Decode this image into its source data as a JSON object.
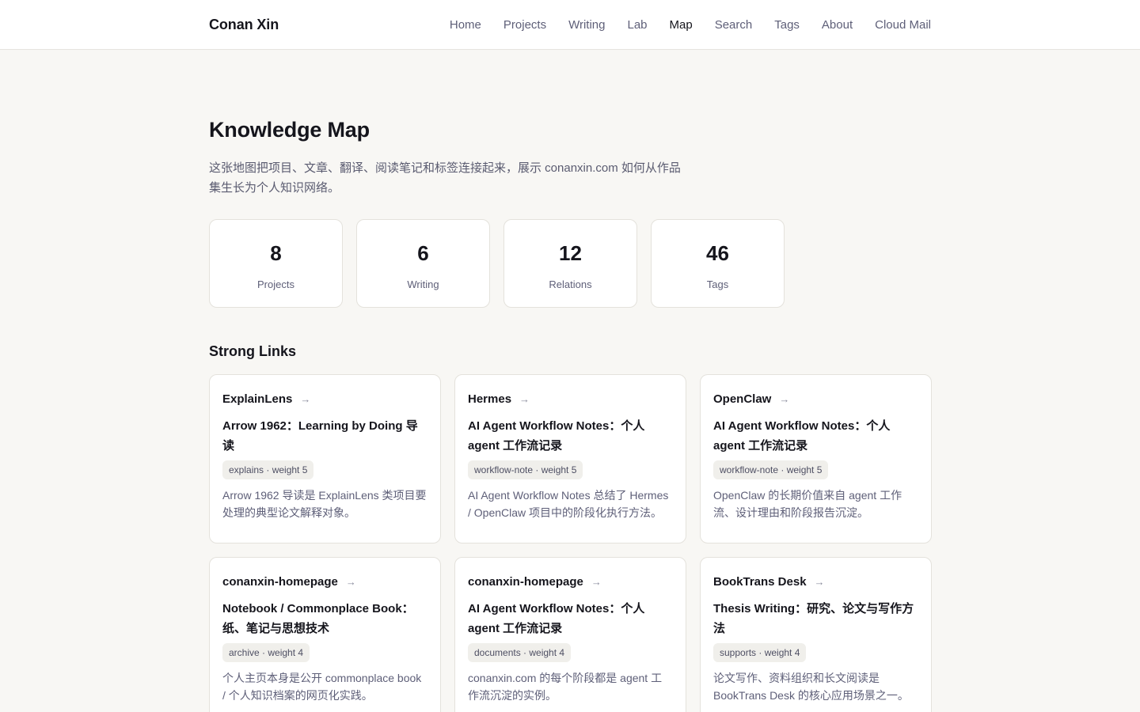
{
  "header": {
    "brand": "Conan Xin",
    "nav": [
      {
        "label": "Home"
      },
      {
        "label": "Projects"
      },
      {
        "label": "Writing"
      },
      {
        "label": "Lab"
      },
      {
        "label": "Map",
        "active": true
      },
      {
        "label": "Search"
      },
      {
        "label": "Tags"
      },
      {
        "label": "About"
      },
      {
        "label": "Cloud Mail"
      }
    ]
  },
  "main": {
    "title": "Knowledge Map",
    "intro": "这张地图把项目、文章、翻译、阅读笔记和标签连接起来，展示 conanxin.com 如何从作品集生长为个人知识网络。",
    "stats": [
      {
        "value": "8",
        "label": "Projects"
      },
      {
        "value": "6",
        "label": "Writing"
      },
      {
        "value": "12",
        "label": "Relations"
      },
      {
        "value": "46",
        "label": "Tags"
      }
    ],
    "strong_links_title": "Strong Links",
    "links": [
      {
        "source": "ExplainLens",
        "arrow": "→",
        "target": "Arrow 1962：Learning by Doing 导读",
        "relation": "explains · weight 5",
        "description": "Arrow 1962 导读是 ExplainLens 类项目要处理的典型论文解释对象。"
      },
      {
        "source": "Hermes",
        "arrow": "→",
        "target": "AI Agent Workflow Notes：个人 agent 工作流记录",
        "relation": "workflow-note · weight 5",
        "description": "AI Agent Workflow Notes 总结了 Hermes / OpenClaw 项目中的阶段化执行方法。"
      },
      {
        "source": "OpenClaw",
        "arrow": "→",
        "target": "AI Agent Workflow Notes：个人 agent 工作流记录",
        "relation": "workflow-note · weight 5",
        "description": "OpenClaw 的长期价值来自 agent 工作流、设计理由和阶段报告沉淀。"
      },
      {
        "source": "conanxin-homepage",
        "arrow": "→",
        "target": "Notebook / Commonplace Book：纸、笔记与思想技术",
        "relation": "archive · weight 4",
        "description": "个人主页本身是公开 commonplace book / 个人知识档案的网页化实践。"
      },
      {
        "source": "conanxin-homepage",
        "arrow": "→",
        "target": "AI Agent Workflow Notes：个人 agent 工作流记录",
        "relation": "documents · weight 4",
        "description": "conanxin.com 的每个阶段都是 agent 工作流沉淀的实例。"
      },
      {
        "source": "BookTrans Desk",
        "arrow": "→",
        "target": "Thesis Writing：研究、论文与写作方法",
        "relation": "supports · weight 4",
        "description": "论文写作、资料组织和长文阅读是 BookTrans Desk 的核心应用场景之一。"
      }
    ]
  }
}
